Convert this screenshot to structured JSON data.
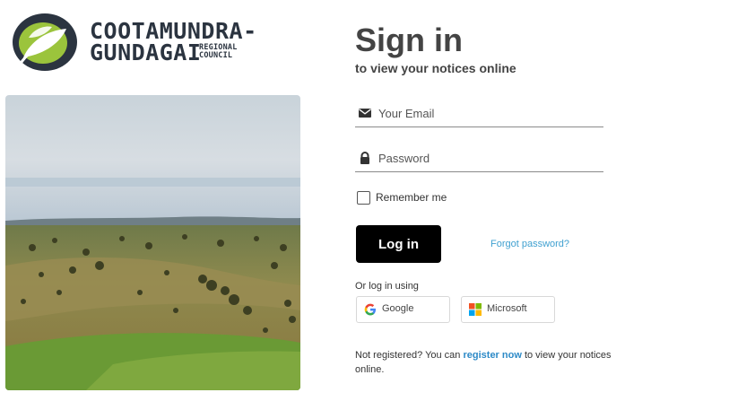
{
  "brand": {
    "line1": "COOTAMUNDRA-",
    "line2": "GUNDAGAI",
    "sub1": "REGIONAL",
    "sub2": "COUNCIL",
    "colors": {
      "green": "#9bc43c",
      "dark": "#2b3440"
    }
  },
  "hero": {
    "image": "aerial-landscape-farmland"
  },
  "form": {
    "title": "Sign in",
    "subtitle": "to view your notices online",
    "email": {
      "placeholder": "Your Email",
      "value": "",
      "icon": "envelope-icon"
    },
    "password": {
      "placeholder": "Password",
      "value": "",
      "icon": "lock-icon"
    },
    "remember_label": "Remember me",
    "remember_checked": false,
    "login_label": "Log in",
    "forgot_label": "Forgot password?",
    "or_label": "Or log in using",
    "google_label": "Google",
    "microsoft_label": "Microsoft",
    "register": {
      "before": "Not registered? You can ",
      "link": "register now",
      "after": " to view your notices online."
    }
  },
  "colors": {
    "button_bg": "#000000",
    "link": "#3fa0d0",
    "register_link": "#2d8ac7"
  }
}
